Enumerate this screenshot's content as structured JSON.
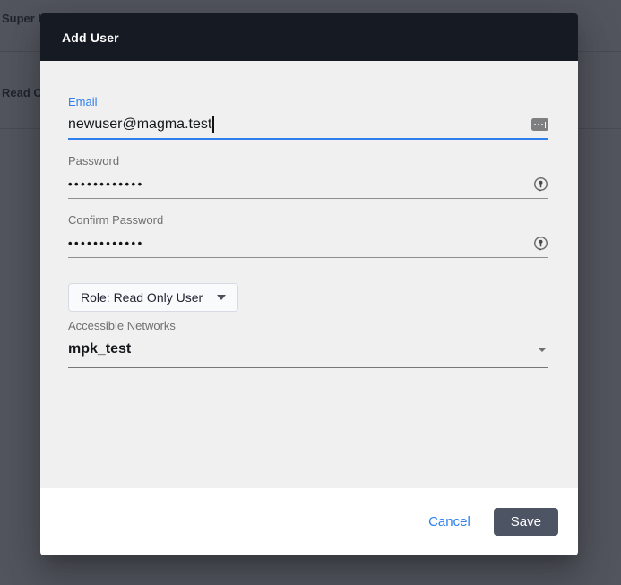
{
  "background": {
    "row1_text": "Super U",
    "row2_text": "Read O"
  },
  "modal": {
    "title": "Add User",
    "fields": {
      "email": {
        "label": "Email",
        "value": "newuser@magma.test"
      },
      "password": {
        "label": "Password",
        "value": "••••••••••••"
      },
      "confirm_password": {
        "label": "Confirm Password",
        "value": "••••••••••••"
      },
      "role": {
        "value": "Role: Read Only User"
      },
      "networks": {
        "label": "Accessible Networks",
        "value": "mpk_test"
      }
    },
    "actions": {
      "cancel": "Cancel",
      "save": "Save"
    }
  },
  "icons": {
    "email_field": "autofill-icon",
    "password_fields": "password-manager-key-icon",
    "dropdowns": "chevron-down-triangle"
  },
  "colors": {
    "header_bg": "#161a23",
    "body_bg": "#f0f0f0",
    "footer_bg": "#ffffff",
    "accent_blue": "#2f80ed",
    "save_button_bg": "#4d5464",
    "label_gray": "#6f6f6f",
    "overlay": "rgba(16,21,32,0.72)"
  }
}
